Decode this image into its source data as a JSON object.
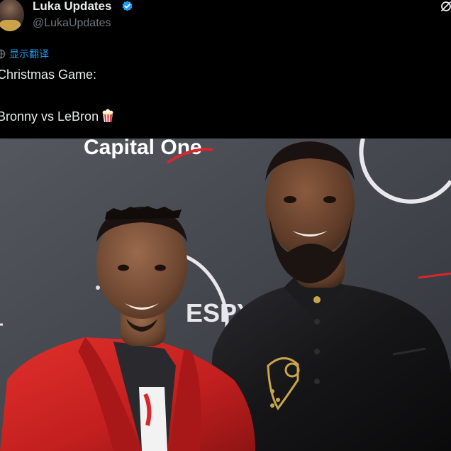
{
  "tweet": {
    "author": {
      "display_name": "Luka Updates",
      "handle": "@LukaUpdates",
      "verified": true
    },
    "translate_label": "显示翻译",
    "text_lines": [
      "Christmas Game:",
      "Bronny vs LeBron"
    ],
    "emoji": "popcorn",
    "media": {
      "backdrop_text": "Capital One",
      "backdrop_text_2": "ESPYS"
    }
  },
  "colors": {
    "background": "#000000",
    "text_primary": "#e7e9ea",
    "text_secondary": "#71767b",
    "accent": "#1d9bf0"
  },
  "icons": [
    "verified-badge-icon",
    "grok-icon",
    "globe-icon",
    "popcorn-icon"
  ]
}
